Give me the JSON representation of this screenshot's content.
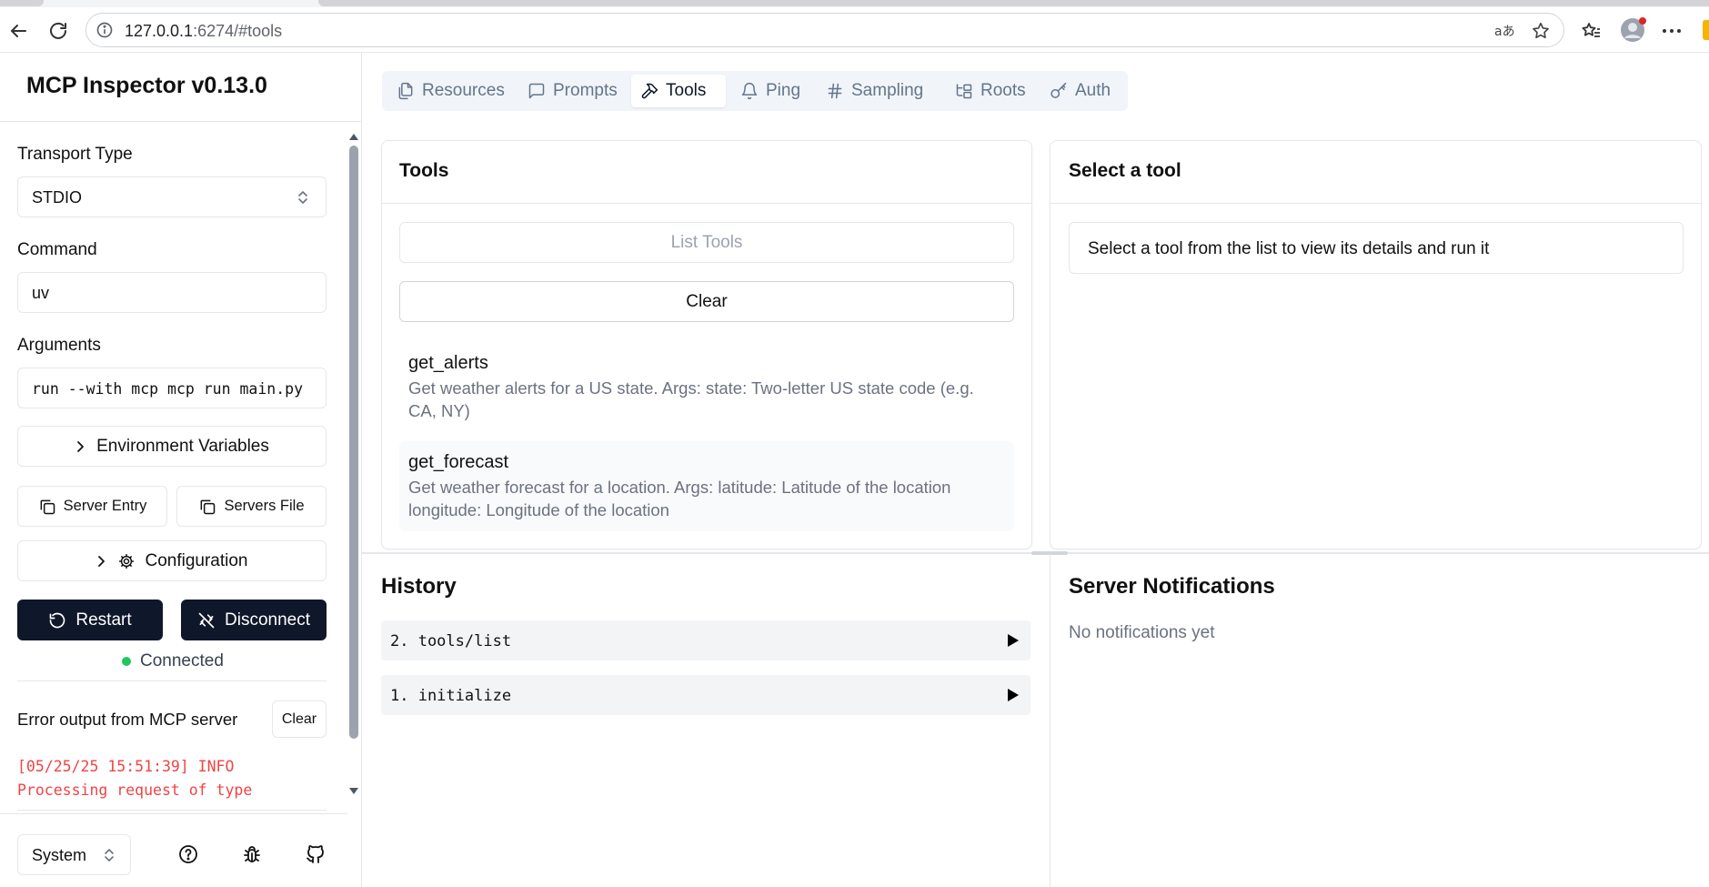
{
  "browser": {
    "url_host": "127.0.0.1",
    "url_rest": ":6274/#tools"
  },
  "sidebar": {
    "title": "MCP Inspector v0.13.0",
    "transport_label": "Transport Type",
    "transport_value": "STDIO",
    "command_label": "Command",
    "command_value": "uv",
    "arguments_label": "Arguments",
    "arguments_value": "run --with mcp mcp run main.py",
    "env_button": "Environment Variables",
    "server_entry_button": "Server Entry",
    "servers_file_button": "Servers File",
    "configuration_button": "Configuration",
    "restart_button": "Restart",
    "disconnect_button": "Disconnect",
    "status_text": "Connected",
    "status_color": "#22c55e",
    "error_label": "Error output from MCP server",
    "error_clear_button": "Clear",
    "error_output": "[05/25/25 15:51:39] INFO Processing request of type",
    "theme_value": "System"
  },
  "tabs": [
    {
      "label": "Resources",
      "icon": "files-icon"
    },
    {
      "label": "Prompts",
      "icon": "message-square-icon"
    },
    {
      "label": "Tools",
      "icon": "hammer-icon",
      "active": true
    },
    {
      "label": "Ping",
      "icon": "bell-icon"
    },
    {
      "label": "Sampling",
      "icon": "hash-icon"
    },
    {
      "label": "Roots",
      "icon": "folder-tree-icon"
    },
    {
      "label": "Auth",
      "icon": "key-icon"
    }
  ],
  "tools_panel": {
    "title": "Tools",
    "list_button": "List Tools",
    "clear_button": "Clear",
    "items": [
      {
        "name": "get_alerts",
        "description": "Get weather alerts for a US state. Args: state: Two-letter US state code (e.g. CA, NY)"
      },
      {
        "name": "get_forecast",
        "description": "Get weather forecast for a location. Args: latitude: Latitude of the location longitude: Longitude of the location"
      }
    ]
  },
  "detail_panel": {
    "title": "Select a tool",
    "message": "Select a tool from the list to view its details and run it"
  },
  "history": {
    "title": "History",
    "items": [
      "2. tools/list",
      "1. initialize"
    ]
  },
  "notifications": {
    "title": "Server Notifications",
    "empty_text": "No notifications yet"
  }
}
